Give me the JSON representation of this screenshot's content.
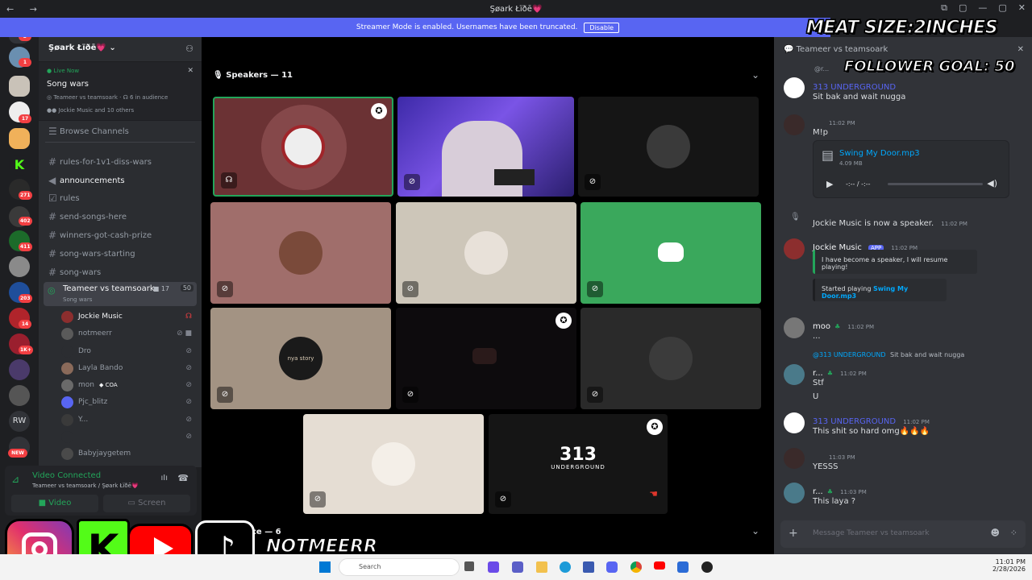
{
  "window": {
    "title": "Şøark Łïðē💗",
    "nav": "←  →",
    "controls": [
      "⧉",
      "▢",
      "—",
      "▢",
      "✕"
    ]
  },
  "banner": {
    "text": "Streamer Mode is enabled. Usernames have been truncated.",
    "button": "Disable"
  },
  "server": {
    "name": "Şøark Łïðē💗"
  },
  "live": {
    "label": "Live Now",
    "title": "Song wars",
    "stage": "Teameer vs teamsoark",
    "audience": "6 in audience",
    "speakers": "Jockie Music and 10 others"
  },
  "browse": "Browse Channels",
  "channels": [
    "rules-for-1v1-diss-wars",
    "announcements",
    "rules",
    "send-songs-here",
    "winners-got-cash-prize",
    "song-wars-starting",
    "song-wars"
  ],
  "voice_channel": {
    "name": "Teameer vs teamsoark",
    "sub": "Song wars",
    "count_a": "17",
    "count_b": "50"
  },
  "voice_users": [
    "Jockie Music",
    "notmeerr",
    "Dro",
    "Layla Bando",
    "mon",
    "Pjc_blitz",
    "Y...",
    "",
    "Babyjaygetem"
  ],
  "mon_tag": "COA",
  "rail_badges": [
    "3",
    "1",
    "17",
    "271",
    "402",
    "411",
    "203",
    "14",
    "1K+",
    "NEW"
  ],
  "rail_rw": "RW",
  "connection": {
    "status": "Video Connected",
    "channel": "Teameer vs teamsoark / Şøark Łïðē💗",
    "video": "Video",
    "screen": "Screen"
  },
  "stage": {
    "speakers_header": "Speakers — 11",
    "audience_header": "ce — 6",
    "tile_texts": {
      "logo": "313",
      "logo_sub": "UNDERGROUND",
      "nia": "nya story"
    }
  },
  "chat": {
    "channel": "Teameer vs teamsoark",
    "messages": [
      {
        "reply": "@r...",
        "name": "313 UNDERGROUND",
        "time": "",
        "text": "Sit bak and wait nugga"
      },
      {
        "name": "",
        "time": "11:02 PM",
        "text": "M!p"
      },
      {
        "attachment": "Swing My Door.mp3",
        "size": "4.09 MB",
        "player": "-:-- / -:--"
      },
      {
        "system": "Jockie Music is now a speaker.",
        "time": "11:02 PM"
      },
      {
        "name": "Jockie Music",
        "app": "APP",
        "time": "11:02 PM",
        "embed1": "I have become a speaker, I will resume playing!",
        "embed2_prefix": "Started playing",
        "embed2_link": "Swing My Door.mp3"
      },
      {
        "name": "moo",
        "time": "11:02 PM",
        "text": "..."
      },
      {
        "reply": "@313 UNDERGROUND",
        "reply_text": "Sit bak and wait nugga",
        "name": "r...",
        "time": "11:02 PM",
        "text": "Stf",
        "text2": "U"
      },
      {
        "name": "313 UNDERGROUND",
        "time": "11:02 PM",
        "text": "This shit so hard omg🔥🔥🔥"
      },
      {
        "name": "",
        "time": "11:03 PM",
        "text": "YESSS"
      },
      {
        "name": "r...",
        "time": "11:03 PM",
        "text": "This laya ?"
      }
    ],
    "input_placeholder": "Message Teameer vs teamsoark"
  },
  "overlays": {
    "meat": "MEAT SIZE:2INCHES",
    "goal": "FOLLOWER GOAL: 50",
    "handle": "NOTMEERR"
  },
  "taskbar": {
    "search": "Search",
    "time": "11:01 PM",
    "date": "2/28/2026"
  },
  "colors": {
    "accent": "#5865f2",
    "green": "#23a55a",
    "red": "#f23f42"
  }
}
